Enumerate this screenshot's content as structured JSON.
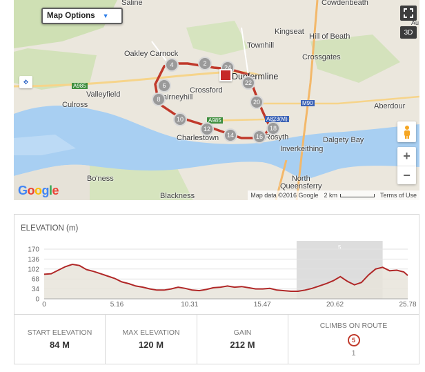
{
  "map": {
    "options_label": "Map Options",
    "fullscreen_icon": "fullscreen-icon",
    "view_3d_label": "3D",
    "logo_text": "Google",
    "attribution": "Map data ©2016 Google",
    "scale_label": "2 km",
    "terms_label": "Terms of Use",
    "places": {
      "saline": "Saline",
      "cowdenbeath": "Cowdenbeath",
      "kingseat": "Kingseat",
      "hill_of_beath": "Hill of Beath",
      "townhill": "Townhill",
      "crossgates": "Crossgates",
      "oakley_carnock": "Oakley Carnock",
      "dunfermline": "Dunfermline",
      "crossford": "Crossford",
      "valleyfield": "Valleyfield",
      "culross": "Culross",
      "cairneyhill": "Cairneyhill",
      "charlestown": "Charlestown",
      "rosyth": "Rosyth",
      "inverkeithing": "Inverkeithing",
      "dalgety_bay": "Dalgety Bay",
      "aberdour": "Aberdour",
      "boness": "Bo'ness",
      "north_queensferry": "North\nQueensferry",
      "blackness": "Blackness",
      "au": "Au"
    },
    "roads": {
      "a985": "A985",
      "a985b": "A985",
      "m90": "M90",
      "a823m": "A823(M)"
    },
    "markers": [
      "4",
      "2",
      "24",
      "6",
      "22",
      "8",
      "20",
      "10",
      "12",
      "14",
      "18",
      "16"
    ],
    "route_color": "#c0392b"
  },
  "elevation": {
    "title": "ELEVATION (m)",
    "climb_marker": "5",
    "chart_data": {
      "type": "area",
      "ylabel": "ELEVATION (m)",
      "yticks": [
        170,
        136,
        102,
        68,
        34,
        0
      ],
      "xticks": [
        0,
        5.16,
        10.31,
        15.47,
        20.62,
        25.78
      ],
      "xlim": [
        0,
        25.78
      ],
      "ylim": [
        0,
        170
      ],
      "highlight_range": [
        17.9,
        24.0
      ],
      "x": [
        0,
        0.5,
        1,
        1.5,
        2,
        2.5,
        3,
        3.5,
        4,
        4.5,
        5,
        5.5,
        6,
        6.5,
        7,
        7.5,
        8,
        8.5,
        9,
        9.5,
        10,
        10.5,
        11,
        11.5,
        12,
        12.5,
        13,
        13.5,
        14,
        14.5,
        15,
        15.5,
        16,
        16.5,
        17,
        17.5,
        18,
        18.5,
        19,
        19.5,
        20,
        20.5,
        21,
        21.5,
        22,
        22.5,
        23,
        23.5,
        24,
        24.5,
        25,
        25.5,
        25.78
      ],
      "y": [
        84,
        86,
        98,
        110,
        118,
        114,
        100,
        94,
        86,
        78,
        70,
        58,
        52,
        44,
        40,
        34,
        30,
        30,
        34,
        40,
        36,
        30,
        28,
        32,
        38,
        40,
        44,
        40,
        42,
        38,
        34,
        34,
        36,
        30,
        28,
        26,
        26,
        30,
        36,
        44,
        52,
        62,
        76,
        60,
        48,
        56,
        82,
        102,
        108,
        96,
        98,
        92,
        80
      ],
      "line_color": "#b02727",
      "fill_color": "#e8e4da",
      "highlight_color": "#cfcfcf"
    }
  },
  "stats": {
    "start_label": "START ELEVATION",
    "start_value": "84 M",
    "max_label": "MAX ELEVATION",
    "max_value": "120 M",
    "gain_label": "GAIN",
    "gain_value": "212 M",
    "climbs_label": "CLIMBS ON ROUTE",
    "climbs_badge": "5",
    "climbs_count": "1"
  }
}
